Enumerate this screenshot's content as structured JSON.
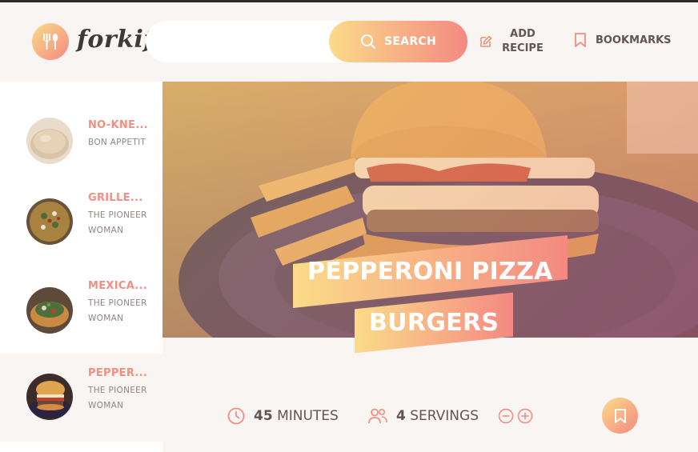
{
  "app": {
    "logo_text": "forkify"
  },
  "search": {
    "placeholder": "",
    "button_label": "SEARCH"
  },
  "nav": {
    "add_recipe_label": "ADD RECIPE",
    "bookmarks_label": "BOOKMARKS"
  },
  "results": [
    {
      "title": "NO-KNE...",
      "publisher": "BON APPETIT",
      "active": false
    },
    {
      "title": "GRILLE...",
      "publisher": "THE PIONEER WOMAN",
      "active": false
    },
    {
      "title": "MEXICA...",
      "publisher": "THE PIONEER WOMAN",
      "active": false
    },
    {
      "title": "PEPPER...",
      "publisher": "THE PIONEER WOMAN",
      "active": true
    }
  ],
  "recipe": {
    "title_line1": "PEPPERONI PIZZA",
    "title_line2": "BURGERS",
    "cooking_time": "45",
    "cooking_unit": "MINUTES",
    "servings": "4",
    "servings_unit": "SERVINGS"
  },
  "colors": {
    "accent_start": "#fbdb89",
    "accent_end": "#f48982",
    "text": "#615551",
    "background": "#f9f5f3"
  },
  "icons": [
    "fork-knife-icon",
    "search-icon",
    "edit-icon",
    "bookmark-icon",
    "clock-icon",
    "users-icon",
    "minus-circle-icon",
    "plus-circle-icon"
  ]
}
